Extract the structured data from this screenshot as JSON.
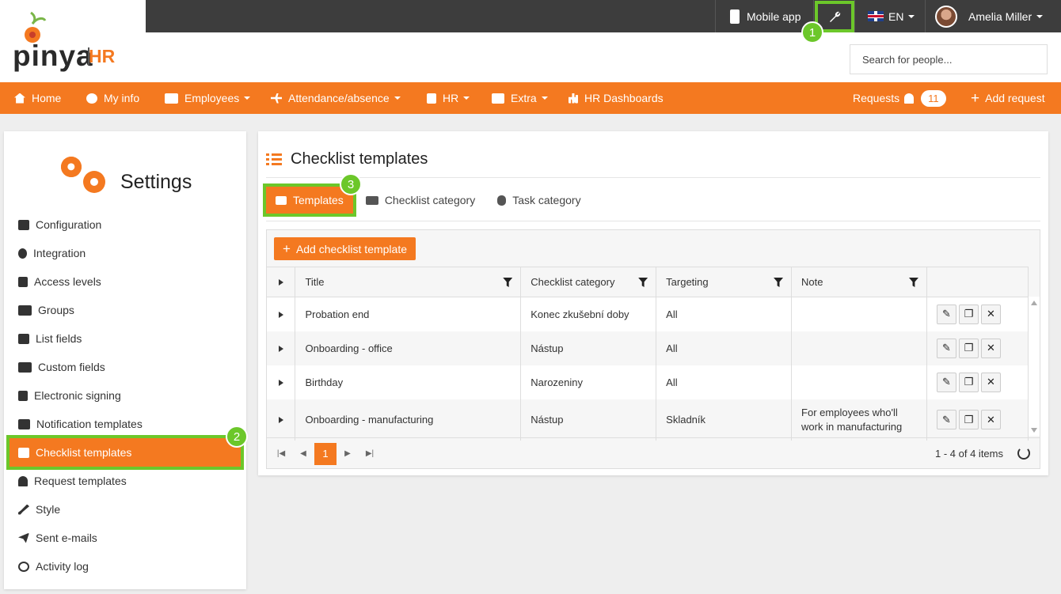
{
  "topbar": {
    "mobile_app": "Mobile app",
    "language": "EN",
    "user_name": "Amelia Miller"
  },
  "logo": {
    "brand": "pinya",
    "suffix": "HR"
  },
  "search": {
    "placeholder": "Search for people..."
  },
  "nav": {
    "home": "Home",
    "my_info": "My info",
    "employees": "Employees",
    "attendance": "Attendance/absence",
    "hr": "HR",
    "extra": "Extra",
    "dashboards": "HR Dashboards",
    "requests": "Requests",
    "requests_count": "11",
    "add_request": "Add request"
  },
  "sidebar": {
    "title": "Settings",
    "items": [
      {
        "label": "Configuration",
        "icon": "wrench-icon"
      },
      {
        "label": "Integration",
        "icon": "share-icon"
      },
      {
        "label": "Access levels",
        "icon": "lock-icon"
      },
      {
        "label": "Groups",
        "icon": "users-icon"
      },
      {
        "label": "List fields",
        "icon": "puzzle-icon"
      },
      {
        "label": "Custom fields",
        "icon": "list-icon"
      },
      {
        "label": "Electronic signing",
        "icon": "sign-icon"
      },
      {
        "label": "Notification templates",
        "icon": "envelope-icon"
      },
      {
        "label": "Checklist templates",
        "icon": "checklist-icon"
      },
      {
        "label": "Request templates",
        "icon": "bell-icon"
      },
      {
        "label": "Style",
        "icon": "brush-icon"
      },
      {
        "label": "Sent e-mails",
        "icon": "paper-plane-icon"
      },
      {
        "label": "Activity log",
        "icon": "history-icon"
      }
    ]
  },
  "main": {
    "title": "Checklist templates",
    "tabs": [
      {
        "label": "Templates"
      },
      {
        "label": "Checklist category"
      },
      {
        "label": "Task category"
      }
    ],
    "add_button": "Add checklist template",
    "columns": [
      "Title",
      "Checklist category",
      "Targeting",
      "Note"
    ],
    "rows": [
      {
        "title": "Probation end",
        "category": "Konec zkušební doby",
        "targeting": "All",
        "note": ""
      },
      {
        "title": "Onboarding - office",
        "category": "Nástup",
        "targeting": "All",
        "note": ""
      },
      {
        "title": "Birthday",
        "category": "Narozeniny",
        "targeting": "All",
        "note": ""
      },
      {
        "title": "Onboarding - manufacturing",
        "category": "Nástup",
        "targeting": "Skladník",
        "note": "For employees who'll work in manufacturing"
      }
    ],
    "pager": {
      "current_page": "1",
      "info": "1 - 4 of 4 items"
    }
  },
  "callouts": [
    "1",
    "2",
    "3"
  ],
  "colors": {
    "accent": "#f47920",
    "highlight": "#6cc72a",
    "topbar": "#3d3d3d"
  }
}
